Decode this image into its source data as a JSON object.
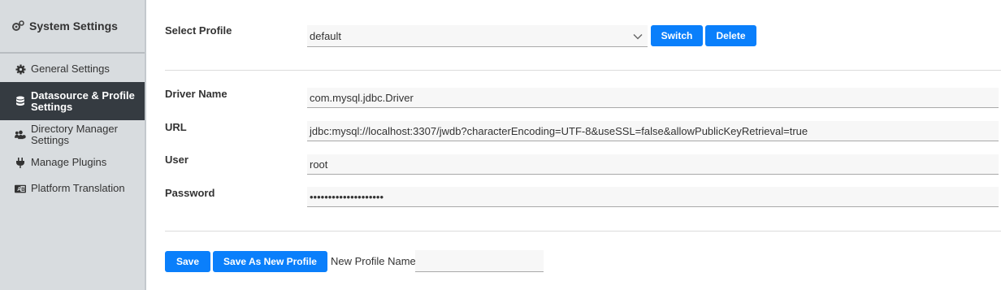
{
  "sidebar": {
    "title": "System Settings",
    "title_icon": "gears-icon",
    "items": [
      {
        "label": "General Settings",
        "icon": "gear-icon",
        "active": false
      },
      {
        "label": "Datasource & Profile Settings",
        "icon": "database-icon",
        "active": true
      },
      {
        "label": "Directory Manager Settings",
        "icon": "users-icon",
        "active": false
      },
      {
        "label": "Manage Plugins",
        "icon": "plug-icon",
        "active": false
      },
      {
        "label": "Platform Translation",
        "icon": "translate-icon",
        "active": false
      }
    ]
  },
  "profile": {
    "label": "Select Profile",
    "selected": "default",
    "switch_label": "Switch",
    "delete_label": "Delete"
  },
  "form": {
    "driver_label": "Driver Name",
    "driver_value": "com.mysql.jdbc.Driver",
    "url_label": "URL",
    "url_value": "jdbc:mysql://localhost:3307/jwdb?characterEncoding=UTF-8&useSSL=false&allowPublicKeyRetrieval=true",
    "user_label": "User",
    "user_value": "root",
    "password_label": "Password",
    "password_value": "••••••••••••••••••••"
  },
  "actions": {
    "save_label": "Save",
    "save_as_label": "Save As New Profile",
    "new_profile_label": "New Profile Name",
    "new_profile_value": ""
  },
  "colors": {
    "accent": "#0a7ffb",
    "sidebar_bg": "#d8dcdf",
    "sidebar_active": "#353b41"
  }
}
